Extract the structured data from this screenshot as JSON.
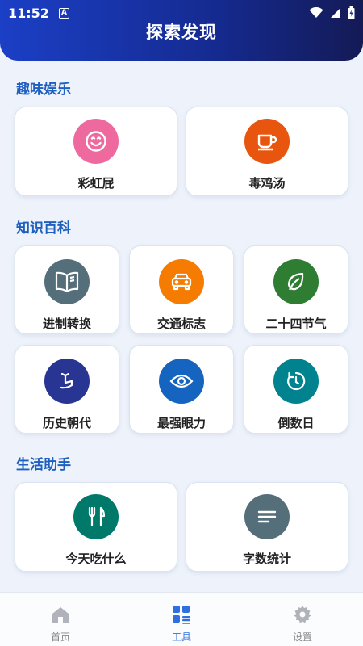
{
  "status": {
    "time": "11:52",
    "input_badge": "A"
  },
  "header": {
    "title": "探索发现"
  },
  "sections": [
    {
      "title": "趣味娱乐"
    },
    {
      "title": "知识百科"
    },
    {
      "title": "生活助手"
    }
  ],
  "tools": {
    "caihongpi": {
      "label": "彩虹屁",
      "icon": "smile-face-icon",
      "color": "#ee6a9e"
    },
    "dujitang": {
      "label": "毒鸡汤",
      "icon": "coffee-cup-icon",
      "color": "#e8550e"
    },
    "jinzhi": {
      "label": "进制转换",
      "icon": "open-book-icon",
      "color": "#546e7a"
    },
    "jiaotong": {
      "label": "交通标志",
      "icon": "car-icon",
      "color": "#f57c00"
    },
    "jieqi": {
      "label": "二十四节气",
      "icon": "leaf-icon",
      "color": "#2e7d32"
    },
    "lishi": {
      "label": "历史朝代",
      "icon": "history-icon",
      "color": "#283593"
    },
    "yanli": {
      "label": "最强眼力",
      "icon": "eye-icon",
      "color": "#1565c0"
    },
    "daoshu": {
      "label": "倒数日",
      "icon": "timer-icon",
      "color": "#00838f"
    },
    "chishenme": {
      "label": "今天吃什么",
      "icon": "fork-knife-icon",
      "color": "#00796b"
    },
    "zishu": {
      "label": "字数统计",
      "icon": "text-lines-icon",
      "color": "#546e7a"
    }
  },
  "nav": {
    "home": {
      "label": "首页",
      "icon": "home-icon"
    },
    "tools": {
      "label": "工具",
      "icon": "grid-tools-icon"
    },
    "settings": {
      "label": "设置",
      "icon": "settings-gear-icon"
    }
  },
  "colors": {
    "accent": "#2f6fe0",
    "section_title": "#1f5fbf",
    "header_start": "#1b3fc6",
    "header_end": "#141a55"
  }
}
